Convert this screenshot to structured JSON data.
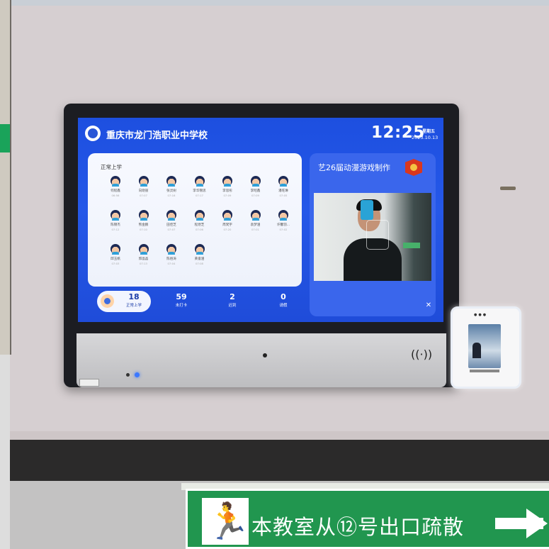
{
  "header": {
    "school_name": "重庆市龙门浩职业中学校",
    "time": "12:25",
    "weekday": "星期五",
    "date": "2023.10.13"
  },
  "attendance": {
    "title": "正常上学",
    "students": [
      {
        "name": "何程鑫",
        "time": "06:56"
      },
      {
        "name": "向晓丽",
        "time": "07:07"
      },
      {
        "name": "张灵树",
        "time": "07:16"
      },
      {
        "name": "李华锦思",
        "time": "07:17"
      },
      {
        "name": "李思彤",
        "time": "07:09"
      },
      {
        "name": "李昭鑫",
        "time": "07:09"
      },
      {
        "name": "潘旺琳",
        "time": "07:05"
      },
      {
        "name": "陈锦杰",
        "time": "07:12"
      },
      {
        "name": "熊金鹏",
        "time": "07:10"
      },
      {
        "name": "田佳芝",
        "time": "07:07"
      },
      {
        "name": "程煜芝",
        "time": "07:06"
      },
      {
        "name": "周梵宇",
        "time": "07:20"
      },
      {
        "name": "袁梦涵",
        "time": "07:01"
      },
      {
        "name": "许馨羽...",
        "time": "07:02"
      },
      {
        "name": "邱玉帆",
        "time": "07:03"
      },
      {
        "name": "郭晶晶",
        "time": "07:13"
      },
      {
        "name": "陈俗涛",
        "time": "07:04"
      },
      {
        "name": "黄俊涵",
        "time": "07:08"
      }
    ]
  },
  "stats": [
    {
      "value": "18",
      "label": "正常上学"
    },
    {
      "value": "59",
      "label": "未打卡"
    },
    {
      "value": "2",
      "label": "迟到"
    },
    {
      "value": "0",
      "label": "请假"
    }
  ],
  "event": {
    "title": "艺26届动漫游戏制作"
  },
  "device": {
    "nfc_symbol": "((·))"
  },
  "sign": {
    "text": "本教室从⑫号出口疏散"
  }
}
